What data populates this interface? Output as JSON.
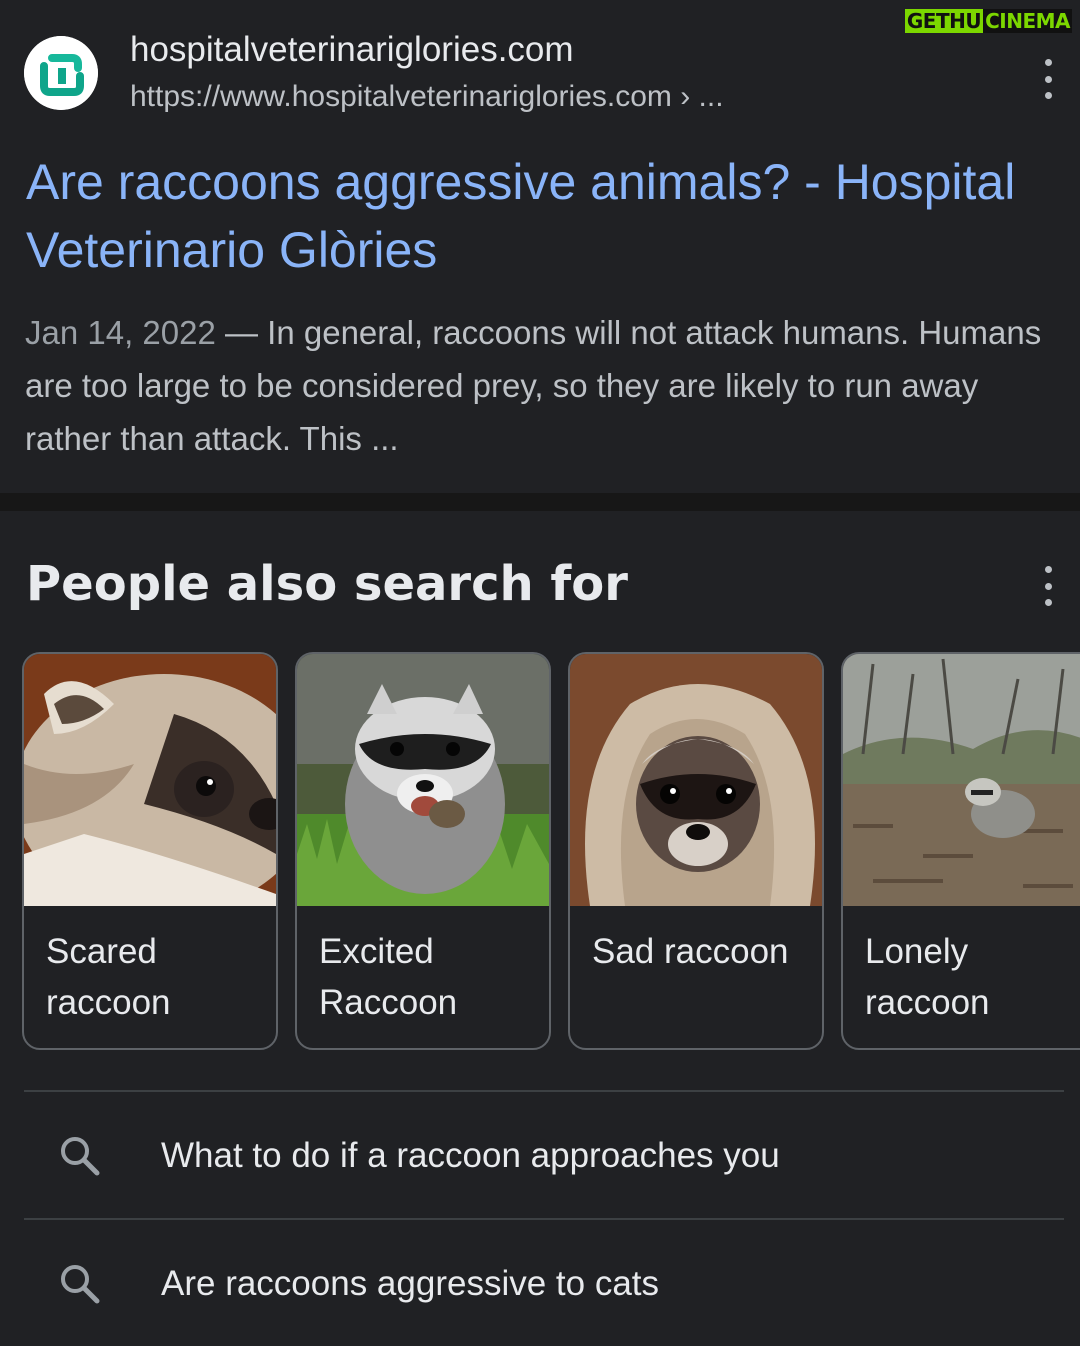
{
  "watermark": {
    "part1": "GETHU",
    "part2": "CINEMA"
  },
  "result": {
    "site_name": "hospitalveterinariglories.com",
    "site_url": "https://www.hospitalveterinariglories.com › ...",
    "title": "Are raccoons aggressive animals? - Hospital Veterinario Glòries",
    "date": "Jan 14, 2022",
    "snippet": " — In general, raccoons will not attack humans. Humans are too large to be considered prey, so they are likely to run away rather than attack. This ..."
  },
  "people_also_search": {
    "title": "People also search for",
    "cards": [
      {
        "label": "Scared raccoon",
        "icon": "scared-raccoon-photo"
      },
      {
        "label": "Excited Raccoon",
        "icon": "excited-raccoon-photo"
      },
      {
        "label": "Sad raccoon",
        "icon": "sad-raccoon-photo"
      },
      {
        "label": "Lonely raccoon",
        "icon": "lonely-raccoon-photo"
      }
    ]
  },
  "related_searches": [
    {
      "text": "What to do if a raccoon approaches you",
      "icon": "search-icon"
    },
    {
      "text": "Are raccoons aggressive to cats",
      "icon": "search-icon"
    }
  ],
  "colors": {
    "background": "#202124",
    "title_link": "#8ab4f8",
    "text_primary": "#e8eaed",
    "text_secondary": "#bdc1c6",
    "card_border": "#5f6368",
    "watermark_green": "#7cd700"
  }
}
